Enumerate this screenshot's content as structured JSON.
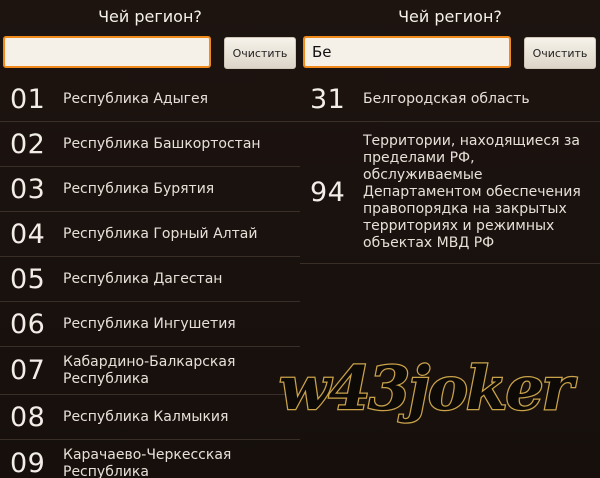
{
  "left": {
    "title": "Чей регион?",
    "search": {
      "value": "",
      "placeholder": ""
    },
    "clear_label": "Очистить",
    "items": [
      {
        "code": "01",
        "name": "Республика Адыгея"
      },
      {
        "code": "02",
        "name": "Республика Башкортостан"
      },
      {
        "code": "03",
        "name": "Республика Бурятия"
      },
      {
        "code": "04",
        "name": "Республика Горный Алтай"
      },
      {
        "code": "05",
        "name": "Республика Дагестан"
      },
      {
        "code": "06",
        "name": "Республика Ингушетия"
      },
      {
        "code": "07",
        "name": "Кабардино-Балкарская Республика"
      },
      {
        "code": "08",
        "name": "Республика Калмыкия"
      },
      {
        "code": "09",
        "name": "Карачаево-Черкесская Республика"
      }
    ]
  },
  "right": {
    "title": "Чей регион?",
    "search": {
      "value": "Бе",
      "placeholder": ""
    },
    "clear_label": "Очистить",
    "items": [
      {
        "code": "31",
        "name": "Белгородская область"
      },
      {
        "code": "94",
        "name": "Территории, находящиеся за пределами РФ, обслуживаемые Департаментом обеспечения правопорядка на закрытых территориях и режимных объектах МВД РФ"
      }
    ]
  },
  "watermark": {
    "text": "w43joker"
  },
  "colors": {
    "background": "#1a110d",
    "input_border_focus": "#f08a1c",
    "divider": "#3a2e28",
    "watermark_fill": "#0d0906",
    "watermark_stroke": "#c9a24a"
  }
}
